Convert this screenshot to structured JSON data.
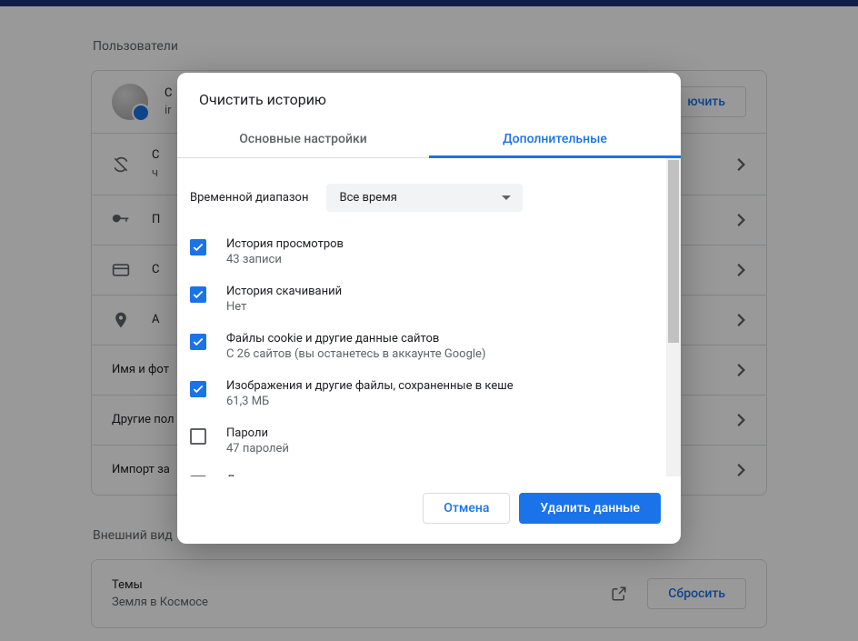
{
  "page": {
    "users_header": "Пользователи",
    "appearance_header": "Внешний вид"
  },
  "profile": {
    "name": "С",
    "email": "ir",
    "disable_button": "ючить"
  },
  "rows": {
    "sync": {
      "title": "С",
      "sub": "ч"
    },
    "passwords": {
      "title": "П"
    },
    "payments": {
      "title": "С"
    },
    "addresses": {
      "title": "А"
    },
    "name_photo": {
      "title": "Имя и фот"
    },
    "other_users": {
      "title": "Другие пол"
    },
    "import": {
      "title": "Импорт за"
    }
  },
  "themes": {
    "title": "Темы",
    "sub": "Земля в Космосе",
    "reset": "Сбросить"
  },
  "dialog": {
    "title": "Очистить историю",
    "tabs": {
      "basic": "Основные настройки",
      "advanced": "Дополнительные"
    },
    "time_label": "Временной диапазон",
    "time_value": "Все время",
    "options": [
      {
        "title": "История просмотров",
        "sub": "43 записи",
        "checked": true
      },
      {
        "title": "История скачиваний",
        "sub": "Нет",
        "checked": true
      },
      {
        "title": "Файлы cookie и другие данные сайтов",
        "sub": "С 26 сайтов (вы останетесь в аккаунте Google)",
        "checked": true
      },
      {
        "title": "Изображения и другие файлы, сохраненные в кеше",
        "sub": "61,3 МБ",
        "checked": true
      },
      {
        "title": "Пароли",
        "sub": "47 паролей",
        "checked": false
      },
      {
        "title": "Данные для автозаполнения",
        "sub": "",
        "checked": false
      }
    ],
    "cancel": "Отмена",
    "confirm": "Удалить данные"
  }
}
